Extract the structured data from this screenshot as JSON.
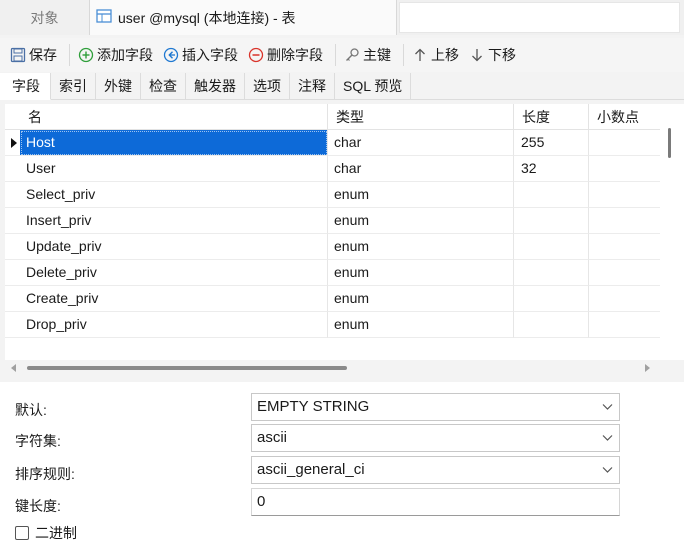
{
  "tabs": {
    "objects_label": "对象",
    "active_label": "user @mysql (本地连接) - 表"
  },
  "toolbar": {
    "save": "保存",
    "add_field": "添加字段",
    "insert_field": "插入字段",
    "delete_field": "删除字段",
    "primary_key": "主键",
    "move_up": "上移",
    "move_down": "下移"
  },
  "subtabs": [
    "字段",
    "索引",
    "外键",
    "检查",
    "触发器",
    "选项",
    "注释",
    "SQL 预览"
  ],
  "grid": {
    "headers": {
      "name": "名",
      "type": "类型",
      "length": "长度",
      "decimals": "小数点"
    },
    "rows": [
      {
        "name": "Host",
        "type": "char",
        "length": "255",
        "decimals": ""
      },
      {
        "name": "User",
        "type": "char",
        "length": "32",
        "decimals": ""
      },
      {
        "name": "Select_priv",
        "type": "enum",
        "length": "",
        "decimals": ""
      },
      {
        "name": "Insert_priv",
        "type": "enum",
        "length": "",
        "decimals": ""
      },
      {
        "name": "Update_priv",
        "type": "enum",
        "length": "",
        "decimals": ""
      },
      {
        "name": "Delete_priv",
        "type": "enum",
        "length": "",
        "decimals": ""
      },
      {
        "name": "Create_priv",
        "type": "enum",
        "length": "",
        "decimals": ""
      },
      {
        "name": "Drop_priv",
        "type": "enum",
        "length": "",
        "decimals": ""
      }
    ],
    "selected_row": 0
  },
  "properties": {
    "default_label": "默认:",
    "default_value": "EMPTY STRING",
    "charset_label": "字符集:",
    "charset_value": "ascii",
    "collation_label": "排序规则:",
    "collation_value": "ascii_general_ci",
    "key_length_label": "键长度:",
    "key_length_value": "0",
    "binary_label": "二进制",
    "binary_checked": false
  },
  "colors": {
    "selection": "#0d6ad8",
    "add_icon": "#2e9e3a",
    "insert_icon": "#1f78d1",
    "delete_icon": "#d9342b"
  }
}
